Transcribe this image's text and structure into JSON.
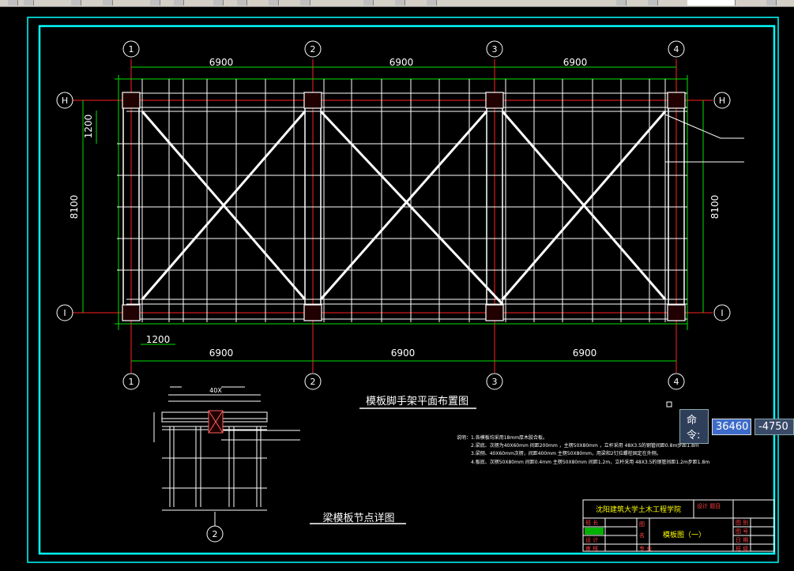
{
  "colors": {
    "frame": "#00ffff",
    "grid": "#ffffff",
    "axis": "#ff2020",
    "dim": "#00ff00",
    "green": "#00e000",
    "magenta": "#ff00ff"
  },
  "plan": {
    "axes_top": [
      "1",
      "2",
      "3",
      "4"
    ],
    "axes_side": [
      "H",
      "I"
    ],
    "spans_top": [
      "6900",
      "6900",
      "6900"
    ],
    "spans_bottom": [
      "6900",
      "6900",
      "6900"
    ],
    "height_left": "8100",
    "height_right": "8100",
    "small_dim_left": "1200",
    "small_dim_bottom": "1200",
    "title": "模板脚手架平面布置图"
  },
  "detail": {
    "title": "梁模板节点详图",
    "axis": "2",
    "dim_top": "40X"
  },
  "notes": {
    "lines": [
      "说明：1.各模板均采用18mm厚木胶合板。",
      "2.梁底、次楞为40X60mm 间距200mm ，主楞50X80mm ，立杆采用 48X3.5的钢管间距0.8m步距1.8m",
      "3.梁侧、40X60mm次楞，间距400mm 主楞50X80mm，用梁和2钉拉螺栓固定在外侧。",
      "4.板底、次楞50X80mm 间距0.4mm 主楞50X80mm 间距1.2m，立杆采用 48X3.5的钢管间距1.2m步距1.8m"
    ]
  },
  "title_block": {
    "school": "沈阳建筑大学土木工程学院",
    "design_label": "设计\n题目",
    "drawing_name": "模板图（一）",
    "left_labels": [
      "班 长",
      "",
      "设 计",
      "审 核"
    ],
    "mid_labels": [
      "图",
      "名",
      "专 业"
    ],
    "right_labels": [
      "图 别",
      "图 号",
      "日 期",
      "班 级"
    ]
  },
  "command": {
    "label": "命令:",
    "value1": "36460",
    "value2": "-4750"
  }
}
